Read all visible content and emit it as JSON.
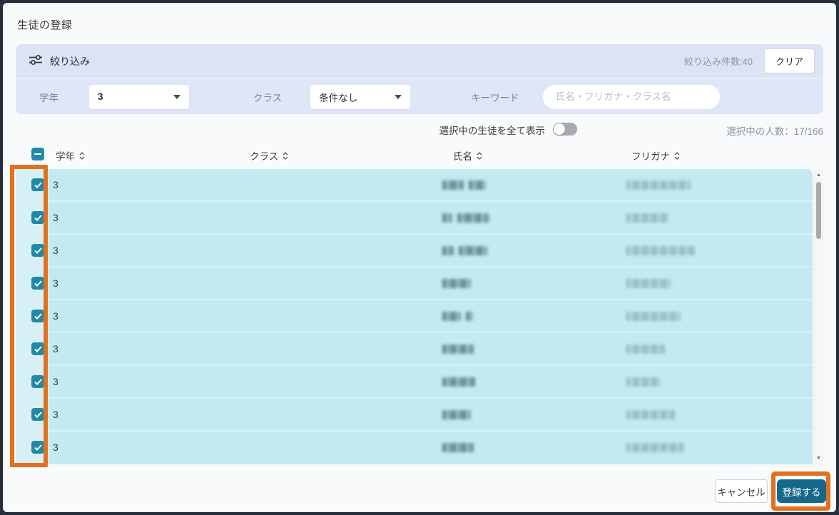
{
  "dialog": {
    "title": "生徒の登録"
  },
  "filter": {
    "title": "絞り込み",
    "count_label": "絞り込み件数:40",
    "clear_button": "クリア",
    "fields": {
      "grade_label": "学年",
      "grade_value": "3",
      "class_label": "クラス",
      "class_value": "条件なし",
      "keyword_label": "キーワード",
      "keyword_placeholder": "氏名・フリガナ・クラス名"
    }
  },
  "selection": {
    "show_all_label": "選択中の生徒を全て表示",
    "toggle_state": "off",
    "count_label": "選択中の人数：17/166"
  },
  "table": {
    "select_all_state": "indeterminate",
    "columns": [
      {
        "label": "学年",
        "sortable": true
      },
      {
        "label": "クラス",
        "sortable": true
      },
      {
        "label": "氏名",
        "sortable": true
      },
      {
        "label": "フリガナ",
        "sortable": true
      }
    ],
    "rows": [
      {
        "grade": "3",
        "checked": true,
        "name_redacted": true,
        "furigana_redacted": true
      },
      {
        "grade": "3",
        "checked": true,
        "name_redacted": true,
        "furigana_redacted": true
      },
      {
        "grade": "3",
        "checked": true,
        "name_redacted": true,
        "furigana_redacted": true
      },
      {
        "grade": "3",
        "checked": true,
        "name_redacted": true,
        "furigana_redacted": true
      },
      {
        "grade": "3",
        "checked": true,
        "name_redacted": true,
        "furigana_redacted": true
      },
      {
        "grade": "3",
        "checked": true,
        "name_redacted": true,
        "furigana_redacted": true
      },
      {
        "grade": "3",
        "checked": true,
        "name_redacted": true,
        "furigana_redacted": true
      },
      {
        "grade": "3",
        "checked": true,
        "name_redacted": true,
        "furigana_redacted": true
      },
      {
        "grade": "3",
        "checked": true,
        "name_redacted": true,
        "furigana_redacted": true
      }
    ]
  },
  "footer": {
    "cancel_button": "キャンセル",
    "submit_button": "登録する"
  },
  "colors": {
    "accent_teal": "#2189a8",
    "submit_teal": "#16688a",
    "row_highlight": "#c3e9f1",
    "filter_bg": "#dee6f7",
    "annotation_orange": "#e2711d",
    "overlay_dark": "#232e3a"
  }
}
